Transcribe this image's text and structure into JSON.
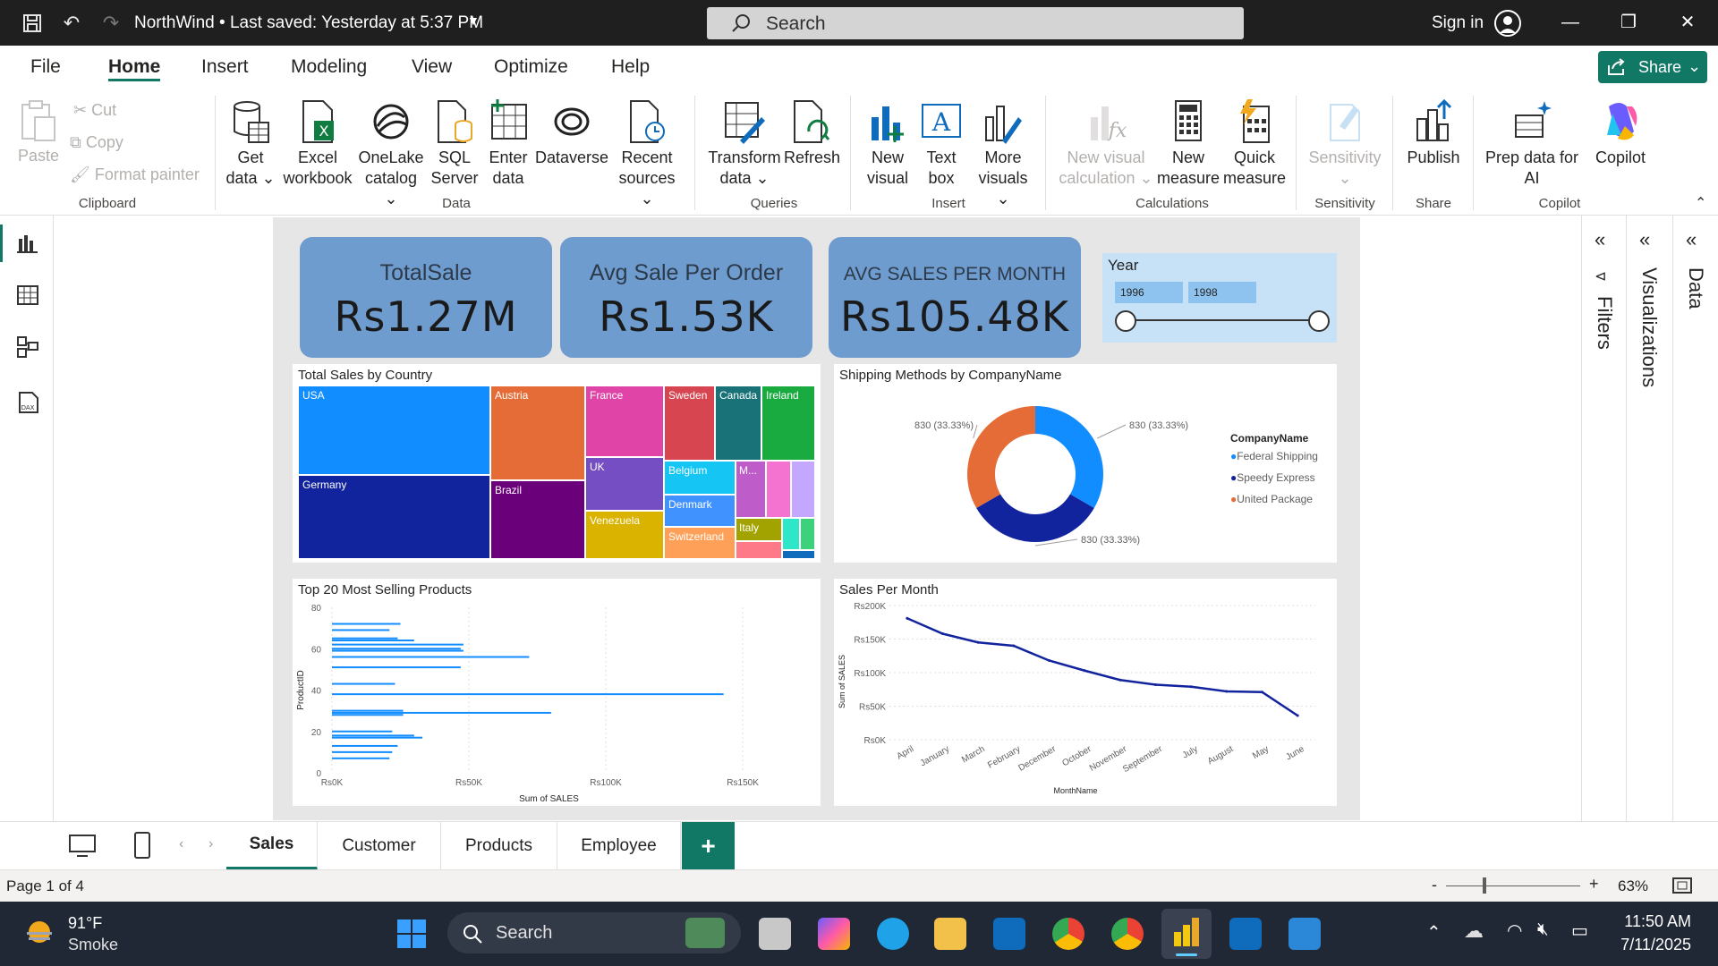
{
  "titlebar": {
    "doc_title": "NorthWind • Last saved: Yesterday at 5:37 PM",
    "search_placeholder": "Search",
    "sign_in": "Sign in"
  },
  "menu": {
    "tabs": [
      "File",
      "Home",
      "Insert",
      "Modeling",
      "View",
      "Optimize",
      "Help"
    ],
    "active": "Home",
    "share": "Share"
  },
  "ribbon": {
    "clipboard": {
      "paste": "Paste",
      "cut": "Cut",
      "copy": "Copy",
      "format_painter": "Format painter",
      "group": "Clipboard"
    },
    "data": {
      "get_data": [
        "Get",
        "data ⌄"
      ],
      "excel": [
        "Excel",
        "workbook"
      ],
      "onelake": [
        "OneLake",
        "catalog ⌄"
      ],
      "sql": [
        "SQL",
        "Server"
      ],
      "enter": [
        "Enter",
        "data"
      ],
      "dataverse": [
        "Dataverse"
      ],
      "recent": [
        "Recent",
        "sources ⌄"
      ],
      "group": "Data"
    },
    "queries": {
      "transform": [
        "Transform",
        "data ⌄"
      ],
      "refresh": [
        "Refresh"
      ],
      "group": "Queries"
    },
    "insert": {
      "new_visual": [
        "New",
        "visual"
      ],
      "text_box": [
        "Text",
        "box"
      ],
      "more_visuals": [
        "More",
        "visuals ⌄"
      ],
      "group": "Insert"
    },
    "calculations": {
      "new_visual_calc": [
        "New visual",
        "calculation ⌄"
      ],
      "new_measure": [
        "New",
        "measure"
      ],
      "quick_measure": [
        "Quick",
        "measure"
      ],
      "group": "Calculations"
    },
    "sensitivity": {
      "label": [
        "Sensitivity",
        "⌄"
      ],
      "group": "Sensitivity"
    },
    "share": {
      "publish": [
        "Publish"
      ],
      "group": "Share"
    },
    "copilot": {
      "prep": [
        "Prep data for",
        "AI"
      ],
      "copilot": [
        "Copilot"
      ],
      "group": "Copilot"
    }
  },
  "kpis": [
    {
      "title": "TotalSale",
      "value": "Rs1.27M"
    },
    {
      "title": "Avg Sale Per Order",
      "value": "Rs1.53K"
    },
    {
      "title": "AVG SALES PER MONTH",
      "value": "Rs105.48K"
    }
  ],
  "slicer": {
    "title": "Year",
    "from": "1996",
    "to": "1998"
  },
  "treemap": {
    "title": "Total Sales by Country",
    "labels": [
      "USA",
      "Germany",
      "Austria",
      "Brazil",
      "France",
      "UK",
      "Venezuela",
      "Sweden",
      "Canada",
      "Ireland",
      "Belgium",
      "Denmark",
      "Switzerland",
      "M...",
      "Italy"
    ]
  },
  "donut": {
    "title": "Shipping Methods by CompanyName",
    "legend_title": "CompanyName",
    "slices": [
      {
        "name": "Federal Shipping",
        "value": 830,
        "label": "830 (33.33%)",
        "color": "#118dff"
      },
      {
        "name": "Speedy Express",
        "value": 830,
        "label": "830 (33.33%)",
        "color": "#12239e"
      },
      {
        "name": "United Package",
        "value": 830,
        "label": "830 (33.33%)",
        "color": "#e66c37"
      }
    ]
  },
  "chart_data": [
    {
      "type": "bar",
      "title": "Top 20 Most Selling Products",
      "xlabel": "Sum of SALES",
      "ylabel": "ProductID",
      "xlim": [
        0,
        165000
      ],
      "ylim": [
        0,
        80
      ],
      "x_ticks": [
        "Rs0K",
        "Rs50K",
        "Rs100K",
        "Rs150K"
      ],
      "y_ticks": [
        "0",
        "20",
        "40",
        "60",
        "80"
      ],
      "bars": [
        {
          "product": 7,
          "sales": 21000
        },
        {
          "product": 10,
          "sales": 22000
        },
        {
          "product": 13,
          "sales": 24000
        },
        {
          "product": 17,
          "sales": 33000
        },
        {
          "product": 18,
          "sales": 30000
        },
        {
          "product": 20,
          "sales": 22000
        },
        {
          "product": 28,
          "sales": 26000
        },
        {
          "product": 29,
          "sales": 80000
        },
        {
          "product": 30,
          "sales": 26000
        },
        {
          "product": 38,
          "sales": 143000
        },
        {
          "product": 43,
          "sales": 23000
        },
        {
          "product": 51,
          "sales": 47000
        },
        {
          "product": 56,
          "sales": 72000
        },
        {
          "product": 59,
          "sales": 48000
        },
        {
          "product": 60,
          "sales": 47000
        },
        {
          "product": 62,
          "sales": 48000
        },
        {
          "product": 64,
          "sales": 30000
        },
        {
          "product": 65,
          "sales": 24000
        },
        {
          "product": 69,
          "sales": 21000
        },
        {
          "product": 72,
          "sales": 25000
        }
      ],
      "color": "#118dff"
    },
    {
      "type": "line",
      "title": "Sales Per Month",
      "xlabel": "MonthName",
      "ylabel": "Sum of SALES",
      "ylim": [
        0,
        200000
      ],
      "y_ticks": [
        "Rs0K",
        "Rs50K",
        "Rs100K",
        "Rs150K",
        "Rs200K"
      ],
      "categories": [
        "April",
        "January",
        "March",
        "February",
        "December",
        "October",
        "November",
        "September",
        "July",
        "August",
        "May",
        "June"
      ],
      "values": [
        181000,
        158000,
        145000,
        140000,
        118000,
        103000,
        89000,
        82000,
        79000,
        72000,
        71000,
        36000
      ],
      "color": "#12239e"
    }
  ],
  "pages": {
    "tabs": [
      "Sales",
      "Customer",
      "Products",
      "Employee"
    ],
    "active": "Sales",
    "add": "+"
  },
  "panes": {
    "filters": "Filters",
    "visualizations": "Visualizations",
    "data": "Data"
  },
  "status": {
    "page": "Page 1 of 4",
    "zoom": "63%"
  },
  "taskbar": {
    "weather_temp": "91°F",
    "weather_desc": "Smoke",
    "search": "Search",
    "time": "11:50 AM",
    "date": "7/11/2025"
  }
}
